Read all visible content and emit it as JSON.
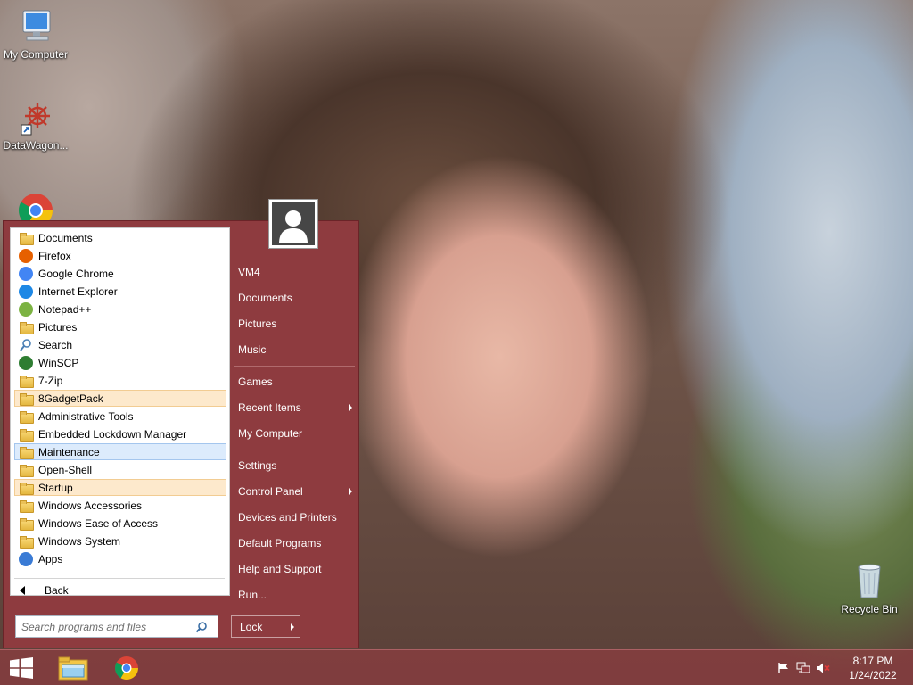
{
  "desktop": {
    "icons": {
      "my_computer": "My Computer",
      "datawagon": "DataWagon...",
      "recycle_bin": "Recycle Bin"
    }
  },
  "start_menu": {
    "programs": [
      {
        "label": "Documents",
        "icon": "documents-folder-icon"
      },
      {
        "label": "Firefox",
        "icon": "firefox-icon"
      },
      {
        "label": "Google Chrome",
        "icon": "chrome-icon"
      },
      {
        "label": "Internet Explorer",
        "icon": "internet-explorer-icon"
      },
      {
        "label": "Notepad++",
        "icon": "notepad-plus-plus-icon"
      },
      {
        "label": "Pictures",
        "icon": "pictures-folder-icon"
      },
      {
        "label": "Search",
        "icon": "search-icon"
      },
      {
        "label": "WinSCP",
        "icon": "winscp-icon"
      },
      {
        "label": "7-Zip",
        "icon": "folder-icon"
      },
      {
        "label": "8GadgetPack",
        "icon": "folder-icon",
        "highlight": "orange"
      },
      {
        "label": "Administrative Tools",
        "icon": "folder-icon"
      },
      {
        "label": "Embedded Lockdown Manager",
        "icon": "folder-icon"
      },
      {
        "label": "Maintenance",
        "icon": "folder-icon",
        "highlight": "blue"
      },
      {
        "label": "Open-Shell",
        "icon": "folder-icon"
      },
      {
        "label": "Startup",
        "icon": "folder-icon",
        "highlight": "orange"
      },
      {
        "label": "Windows Accessories",
        "icon": "folder-icon"
      },
      {
        "label": "Windows Ease of Access",
        "icon": "folder-icon"
      },
      {
        "label": "Windows System",
        "icon": "folder-icon"
      },
      {
        "label": "Apps",
        "icon": "apps-icon"
      }
    ],
    "back_label": "Back",
    "search_placeholder": "Search programs and files",
    "right_items": [
      {
        "label": "VM4",
        "submenu": false
      },
      {
        "label": "Documents",
        "submenu": false
      },
      {
        "label": "Pictures",
        "submenu": false
      },
      {
        "label": "Music",
        "submenu": false
      },
      {
        "label": "Games",
        "submenu": false
      },
      {
        "label": "Recent Items",
        "submenu": true
      },
      {
        "label": "My Computer",
        "submenu": false
      },
      {
        "label": "Settings",
        "submenu": false
      },
      {
        "label": "Control Panel",
        "submenu": true
      },
      {
        "label": "Devices and Printers",
        "submenu": false
      },
      {
        "label": "Default Programs",
        "submenu": false
      },
      {
        "label": "Help and Support",
        "submenu": false
      },
      {
        "label": "Run...",
        "submenu": false
      }
    ],
    "lock_label": "Lock"
  },
  "taskbar": {
    "clock_time": "8:17 PM",
    "clock_date": "1/24/2022"
  },
  "colors": {
    "menu_bg": "#8e3b3f",
    "highlight_orange": "#fde9cc",
    "highlight_blue": "#dcebfc"
  }
}
